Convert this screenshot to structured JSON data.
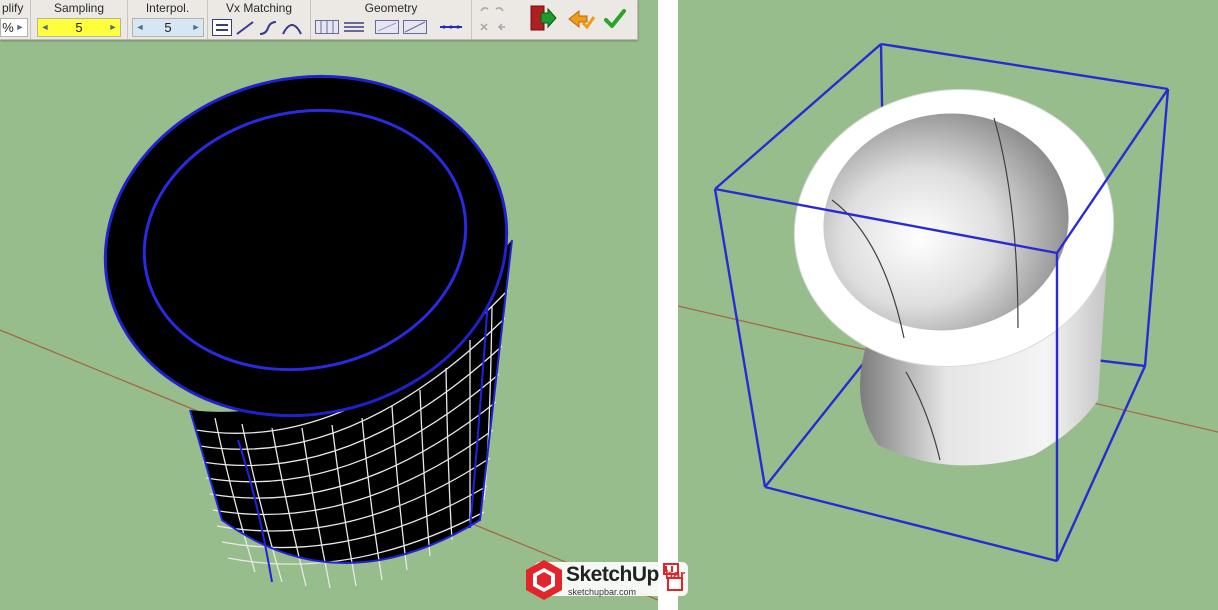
{
  "toolbar": {
    "groups": {
      "simplify": {
        "label": "plify",
        "value": "%"
      },
      "sampling": {
        "label": "Sampling",
        "value": "5"
      },
      "interpol": {
        "label": "Interpol.",
        "value": "5"
      },
      "vx_matching": {
        "label": "Vx Matching"
      },
      "geometry": {
        "label": "Geometry"
      }
    },
    "colors": {
      "sampling_field": "#ffff3c",
      "interpol_field": "#d6e6f2",
      "validate": "#2aa52a",
      "undo": "#f29a1a"
    },
    "icons": [
      "undo-icon",
      "redo-icon",
      "exit-icon",
      "revert-icon",
      "validate-checkmark-icon"
    ]
  },
  "viewport": {
    "background": "#98bd8c"
  },
  "watermark": {
    "brand": "SketchUp",
    "suffix": "bar",
    "url": "sketchupbar.com",
    "color": "#e1262b"
  }
}
